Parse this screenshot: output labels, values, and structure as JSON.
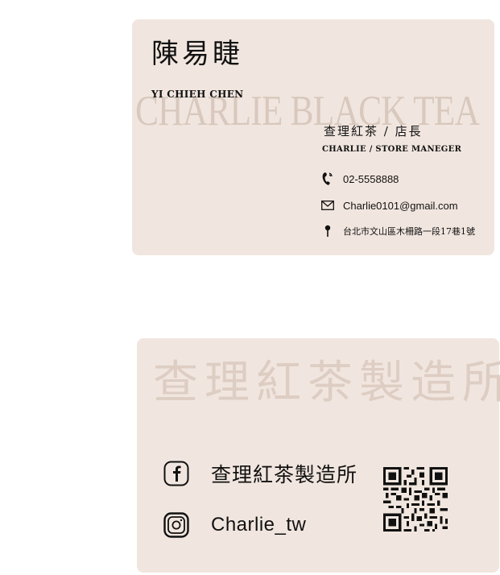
{
  "front": {
    "name_zh": "陳易睫",
    "name_en": "YI CHIEH CHEN",
    "watermark": "CHARLIE BLACK TEA",
    "title_zh": "查理紅茶 / 店長",
    "title_en": "CHARLIE / STORE MANEGER",
    "phone": "02-5558888",
    "email": "Charlie0101@gmail.com",
    "address": "台北市文山區木柵路一段17巷1號",
    "icons": {
      "phone": "phone-icon",
      "email": "envelope-icon",
      "address": "location-pin-icon"
    }
  },
  "back": {
    "brand": "查理紅茶製造所",
    "facebook": "查理紅茶製造所",
    "instagram": "Charlie_tw",
    "icons": {
      "facebook": "facebook-icon",
      "instagram": "instagram-icon",
      "qr": "qr-code"
    }
  },
  "colors": {
    "card": "#f1e6df",
    "watermark": "#d8c8bd",
    "text": "#111111"
  }
}
